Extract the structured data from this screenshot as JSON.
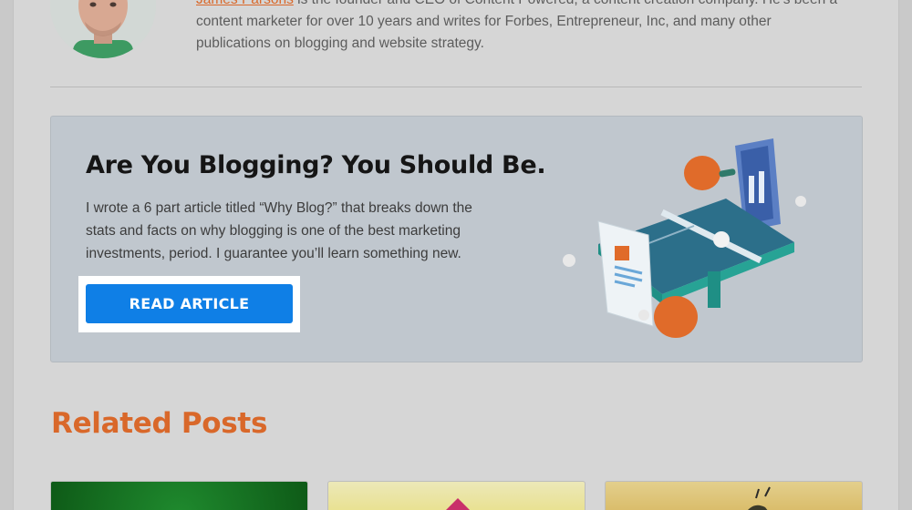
{
  "bio": {
    "author_link": "James Parsons",
    "line1_rest": " is the founder and CEO of Content Powered, a content creation company. He's been a",
    "line2": "content marketer for over 10 years and writes for Forbes, Entrepreneur, Inc, and many other",
    "line3": "publications on blogging and website strategy."
  },
  "cta": {
    "title": "Are You Blogging? You Should Be.",
    "body": "I wrote a 6 part article titled “Why Blog?” that breaks down the stats and facts on why blogging is one of the best marketing investments, period. I guarantee you’ll learn something new.",
    "button_label": "READ ARTICLE"
  },
  "related": {
    "heading": "Related Posts"
  },
  "colors": {
    "accent": "#d9682a",
    "button": "#0f7fe6"
  }
}
